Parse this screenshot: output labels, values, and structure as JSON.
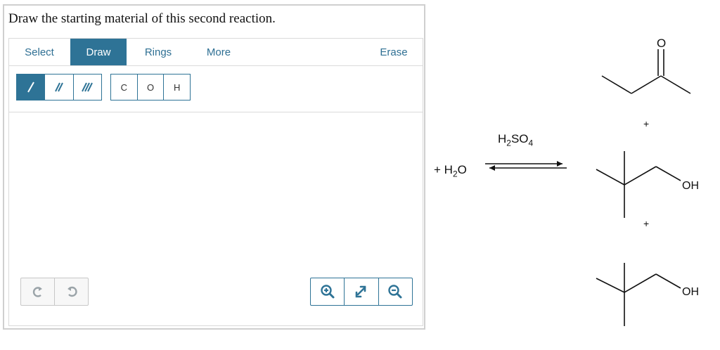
{
  "question": "Draw the starting material of this second reaction.",
  "toolbar": {
    "tabs": [
      "Select",
      "Draw",
      "Rings",
      "More"
    ],
    "erase": "Erase"
  },
  "atoms": [
    "C",
    "O",
    "H"
  ],
  "icons": {
    "single_bond": "single-bond-icon",
    "double_bond": "double-bond-icon",
    "triple_bond": "triple-bond-icon",
    "undo": "undo-icon",
    "redo": "redo-icon",
    "zoom_in": "zoom-in-icon",
    "reset_zoom": "reset-zoom-icon",
    "zoom_out": "zoom-out-icon"
  },
  "colors": {
    "accent": "#2e7396",
    "border": "#cfcfcf"
  },
  "reaction": {
    "reagent_above_arrow": {
      "base": "H",
      "sub1": "2",
      "mid": "SO",
      "sub2": "4"
    },
    "added_reactant": {
      "plus": "+",
      "base": "H",
      "sub": "2",
      "tail": "O"
    },
    "plus": "+",
    "oh": "OH",
    "ketone_o": "O"
  }
}
